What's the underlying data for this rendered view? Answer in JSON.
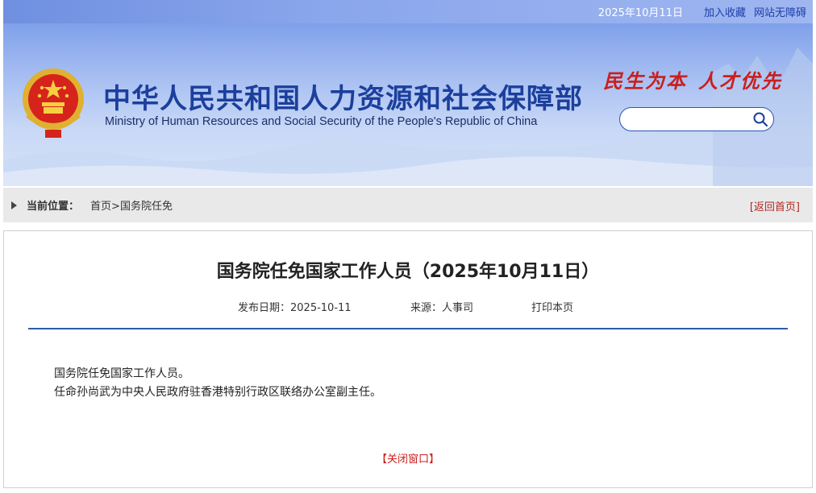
{
  "topbar": {
    "date": "2025年10月11日",
    "links": [
      "加入收藏",
      "网站无障碍"
    ]
  },
  "header": {
    "title_cn": "中华人民共和国人力资源和社会保障部",
    "title_en": "Ministry of Human Resources and Social Security of the People's Republic of China",
    "slogan": [
      "民生为本",
      "人才优先"
    ],
    "search_placeholder": ""
  },
  "breadcrumb": {
    "label": "当前位置：",
    "home": "首页",
    "separator": ">",
    "current": "国务院任免",
    "back_link": "[返回首页]"
  },
  "article": {
    "title": "国务院任免国家工作人员（2025年10月11日）",
    "publish_date": "发布日期：2025-10-11",
    "source": "来源：人事司",
    "print": "打印本页",
    "paragraphs": [
      "国务院任免国家工作人员。",
      "任命孙尚武为中央人民政府驻香港特别行政区联络办公室副主任。"
    ],
    "close_link": "【关闭窗口】"
  },
  "colors": {
    "brand_blue": "#1c3f9c",
    "slogan_red": "#c8201f",
    "rule_blue": "#2a5fa4"
  }
}
